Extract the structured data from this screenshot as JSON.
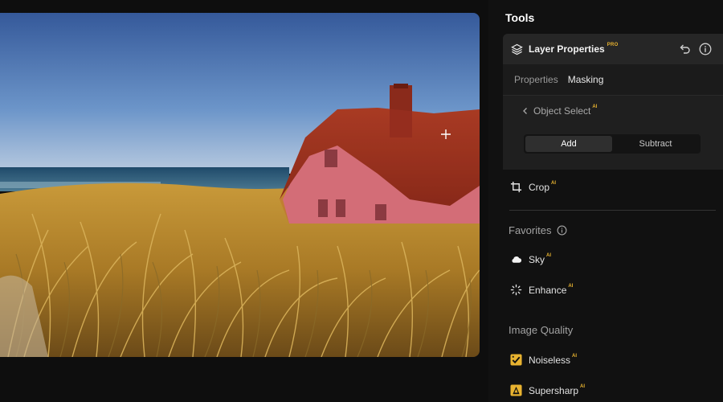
{
  "panel": {
    "title": "Tools"
  },
  "layer_properties": {
    "title": "Layer Properties",
    "badge": "PRO",
    "tabs": [
      {
        "label": "Properties",
        "active": false
      },
      {
        "label": "Masking",
        "active": true
      }
    ],
    "back_label": "Object Select",
    "back_badge": "AI",
    "mode_buttons": [
      {
        "label": "Add",
        "selected": true
      },
      {
        "label": "Subtract",
        "selected": false
      }
    ]
  },
  "tools": {
    "crop": {
      "label": "Crop",
      "badge": "AI",
      "icon": "crop-icon"
    }
  },
  "favorites": {
    "title": "Favorites",
    "items": [
      {
        "label": "Sky",
        "badge": "AI",
        "icon": "cloud-icon"
      },
      {
        "label": "Enhance",
        "badge": "AI",
        "icon": "sparkle-icon"
      }
    ]
  },
  "image_quality": {
    "title": "Image Quality",
    "items": [
      {
        "label": "Noiseless",
        "badge": "AI",
        "icon": "noiseless-icon"
      },
      {
        "label": "Supersharp",
        "badge": "AI",
        "icon": "supersharp-icon"
      }
    ]
  },
  "colors": {
    "accent_ai": "#e8b330",
    "mask_overlay": "#c0392b"
  }
}
